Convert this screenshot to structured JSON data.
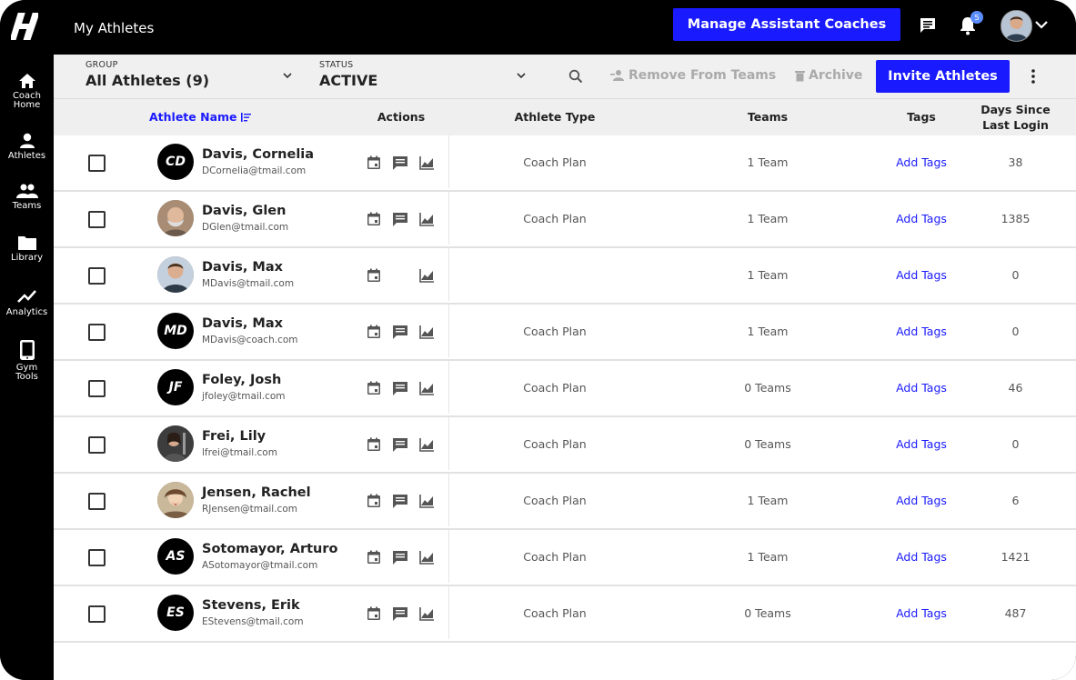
{
  "app": {
    "page_title": "My Athletes",
    "manage_button": "Manage Assistant Coaches",
    "notification_count": "5"
  },
  "colors": {
    "accent": "#1a1aff",
    "sidebar": "#000000",
    "link": "#1a1aff"
  },
  "sidebar": {
    "items": [
      {
        "label_line1": "Coach",
        "label_line2": "Home",
        "icon": "home-icon"
      },
      {
        "label_line1": "Athletes",
        "label_line2": "",
        "icon": "person-icon"
      },
      {
        "label_line1": "Teams",
        "label_line2": "",
        "icon": "group-icon"
      },
      {
        "label_line1": "Library",
        "label_line2": "",
        "icon": "folder-icon"
      },
      {
        "label_line1": "Analytics",
        "label_line2": "",
        "icon": "trend-icon"
      },
      {
        "label_line1": "Gym",
        "label_line2": "Tools",
        "icon": "tablet-icon"
      }
    ]
  },
  "filters": {
    "group_label": "GROUP",
    "group_value": "All Athletes (9)",
    "status_label": "STATUS",
    "status_value": "ACTIVE",
    "remove_label": "Remove From Teams",
    "archive_label": "Archive",
    "invite_label": "Invite Athletes"
  },
  "table": {
    "headers": {
      "name": "Athlete Name",
      "actions": "Actions",
      "type": "Athlete Type",
      "teams": "Teams",
      "tags": "Tags",
      "days_line1": "Days Since",
      "days_line2": "Last Login"
    },
    "rows": [
      {
        "initials": "CD",
        "name": "Davis, Cornelia",
        "email": "DCornelia@tmail.com",
        "type": "Coach Plan",
        "teams": "1 Team",
        "tags": "Add Tags",
        "days": "38"
      },
      {
        "initials": "",
        "name": "Davis, Glen",
        "email": "DGlen@tmail.com",
        "type": "Coach Plan",
        "teams": "1 Team",
        "tags": "Add Tags",
        "days": "1385"
      },
      {
        "initials": "",
        "name": "Davis, Max",
        "email": "MDavis@tmail.com",
        "type": "",
        "teams": "1 Team",
        "tags": "Add Tags",
        "days": "0"
      },
      {
        "initials": "MD",
        "name": "Davis, Max",
        "email": "MDavis@coach.com",
        "type": "Coach Plan",
        "teams": "1 Team",
        "tags": "Add Tags",
        "days": "0"
      },
      {
        "initials": "JF",
        "name": "Foley, Josh",
        "email": "jfoley@tmail.com",
        "type": "Coach Plan",
        "teams": "0 Teams",
        "tags": "Add Tags",
        "days": "46"
      },
      {
        "initials": "",
        "name": "Frei, Lily",
        "email": "lfrei@tmail.com",
        "type": "Coach Plan",
        "teams": "0 Teams",
        "tags": "Add Tags",
        "days": "0"
      },
      {
        "initials": "",
        "name": "Jensen, Rachel",
        "email": "RJensen@tmail.com",
        "type": "Coach Plan",
        "teams": "1 Team",
        "tags": "Add Tags",
        "days": "6"
      },
      {
        "initials": "AS",
        "name": "Sotomayor, Arturo",
        "email": "ASotomayor@tmail.com",
        "type": "Coach Plan",
        "teams": "1 Team",
        "tags": "Add Tags",
        "days": "1421"
      },
      {
        "initials": "ES",
        "name": "Stevens, Erik",
        "email": "EStevens@tmail.com",
        "type": "Coach Plan",
        "teams": "0 Teams",
        "tags": "Add Tags",
        "days": "487"
      }
    ]
  }
}
